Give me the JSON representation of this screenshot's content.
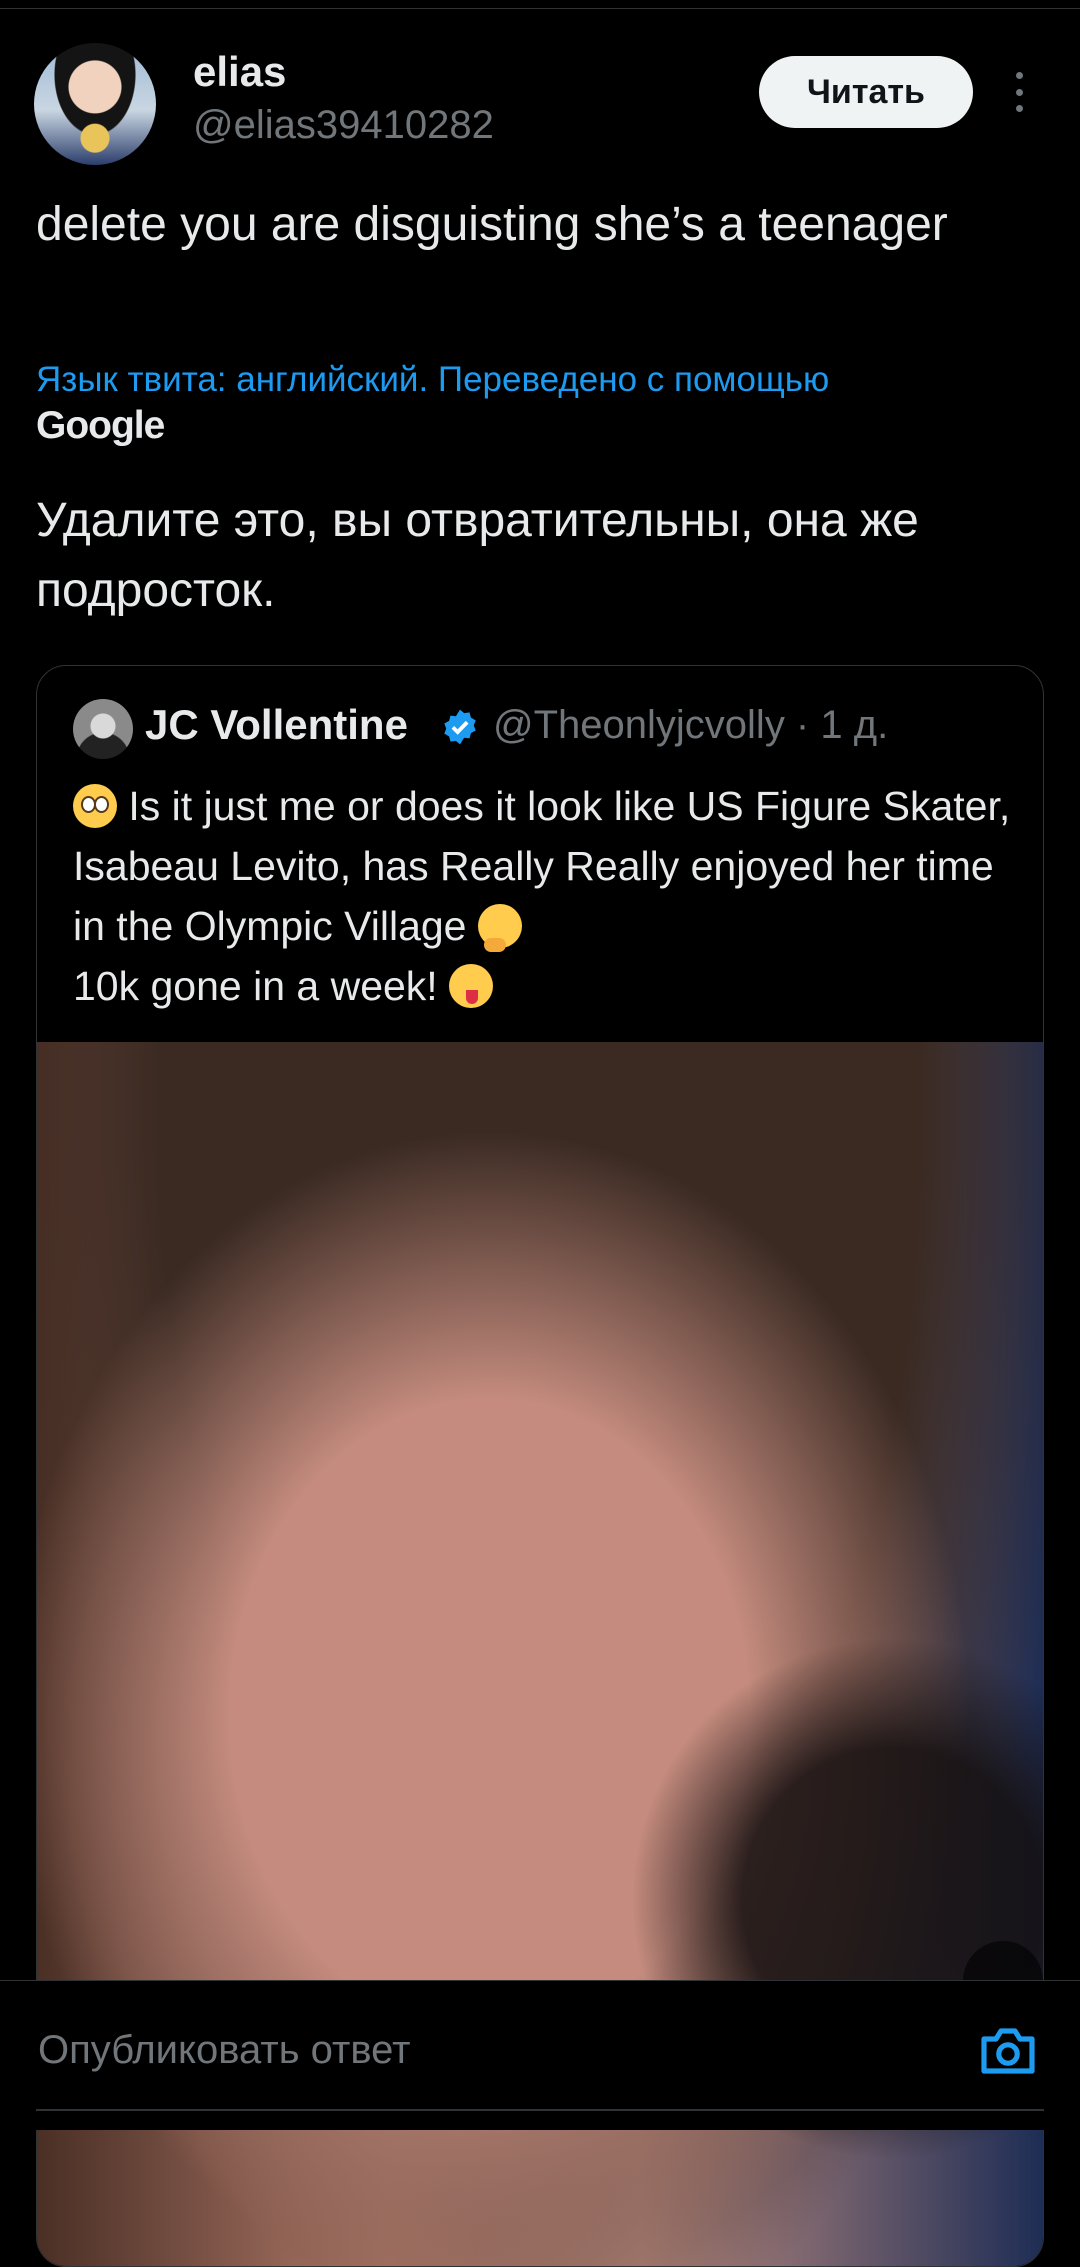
{
  "author": {
    "display_name": "elias",
    "handle": "@elias39410282",
    "follow_label": "Читать"
  },
  "tweet": {
    "text": "delete you are disguisting she’s a teenager",
    "translation_note": "Язык твита: английский. Переведено с помощью",
    "translation_provider": "Google",
    "translated_text": "Удалите это, вы отвратительны, она же подросток."
  },
  "quoted_tweet": {
    "display_name": "JC Vollentine",
    "handle_time": "@Theonlyjcvolly · 1 д.",
    "text_part1": " Is it just me or does it look like US Figure Skater, Isabeau Levito, has Really Really enjoyed her time in the Olympic Village ",
    "text_part2": " 10k gone in a week! ",
    "verified_color": "#1d9bf0"
  },
  "reply": {
    "placeholder": "Опубликовать ответ"
  },
  "colors": {
    "background": "#000000",
    "text": "#e7e9ea",
    "secondary": "#71767b",
    "link": "#1d9bf0"
  }
}
